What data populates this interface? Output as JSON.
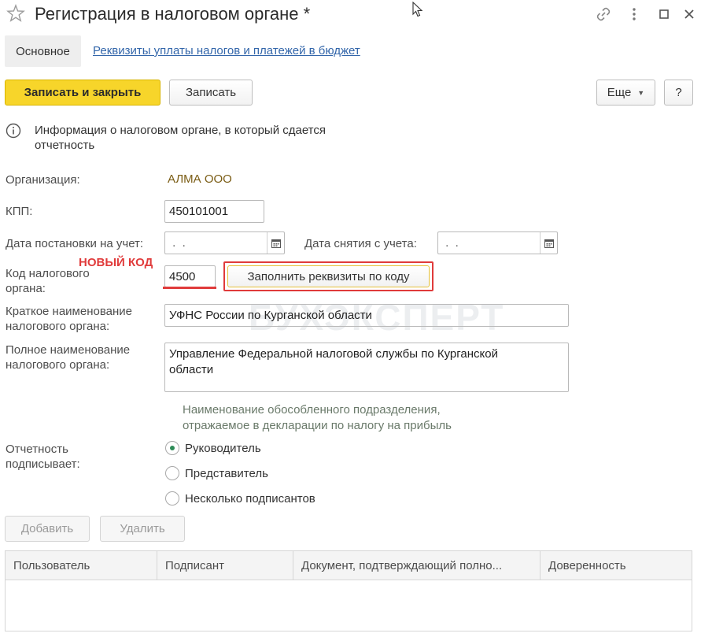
{
  "window": {
    "title": "Регистрация в налоговом органе *"
  },
  "tabs": {
    "main": "Основное",
    "link": "Реквизиты уплаты налогов и платежей в бюджет"
  },
  "toolbar": {
    "save_close": "Записать и закрыть",
    "save": "Записать",
    "more": "Еще",
    "help": "?"
  },
  "info": {
    "text": "Информация о налоговом органе, в который сдается отчетность"
  },
  "form": {
    "org_label": "Организация:",
    "org_value": "АЛМА ООО",
    "kpp_label": "КПП:",
    "kpp_value": "450101001",
    "reg_date_label": "Дата постановки на учет:",
    "reg_date_value": " .  .",
    "unreg_date_label": "Дата снятия с учета:",
    "unreg_date_value": " .  .",
    "code_label_line1": "Код налогового",
    "code_label_line2": "органа:",
    "code_value": "4500",
    "fill_button": "Заполнить реквизиты по коду",
    "new_code_note": "НОВЫЙ КОД",
    "short_name_label_line1": "Краткое наименование",
    "short_name_label_line2": "налогового органа:",
    "short_name_value": "УФНС России по Курганской области",
    "full_name_label_line1": "Полное наименование",
    "full_name_label_line2": "налогового органа:",
    "full_name_value_line1": "Управление Федеральной налоговой службы по Курганской",
    "full_name_value_line2": "области",
    "hint_line1": "Наименование обособленного подразделения,",
    "hint_line2": "отражаемое в декларации по налогу на прибыль",
    "signer_label_line1": "Отчетность",
    "signer_label_line2": "подписывает:",
    "signer_options": [
      "Руководитель",
      "Представитель",
      "Несколько подписантов"
    ],
    "signer_selected": "Руководитель"
  },
  "signers": {
    "add_button": "Добавить",
    "delete_button": "Удалить",
    "columns": [
      "Пользователь",
      "Подписант",
      "Документ, подтверждающий полно...",
      "Доверенность"
    ]
  },
  "watermark": "БУХЭКСПЕРТ",
  "colors": {
    "accent_yellow": "#f7d52a",
    "link_blue": "#3366aa",
    "note_red": "#e03b3b",
    "org_value": "#7a5c14",
    "radio_selected": "#2e8b57"
  }
}
